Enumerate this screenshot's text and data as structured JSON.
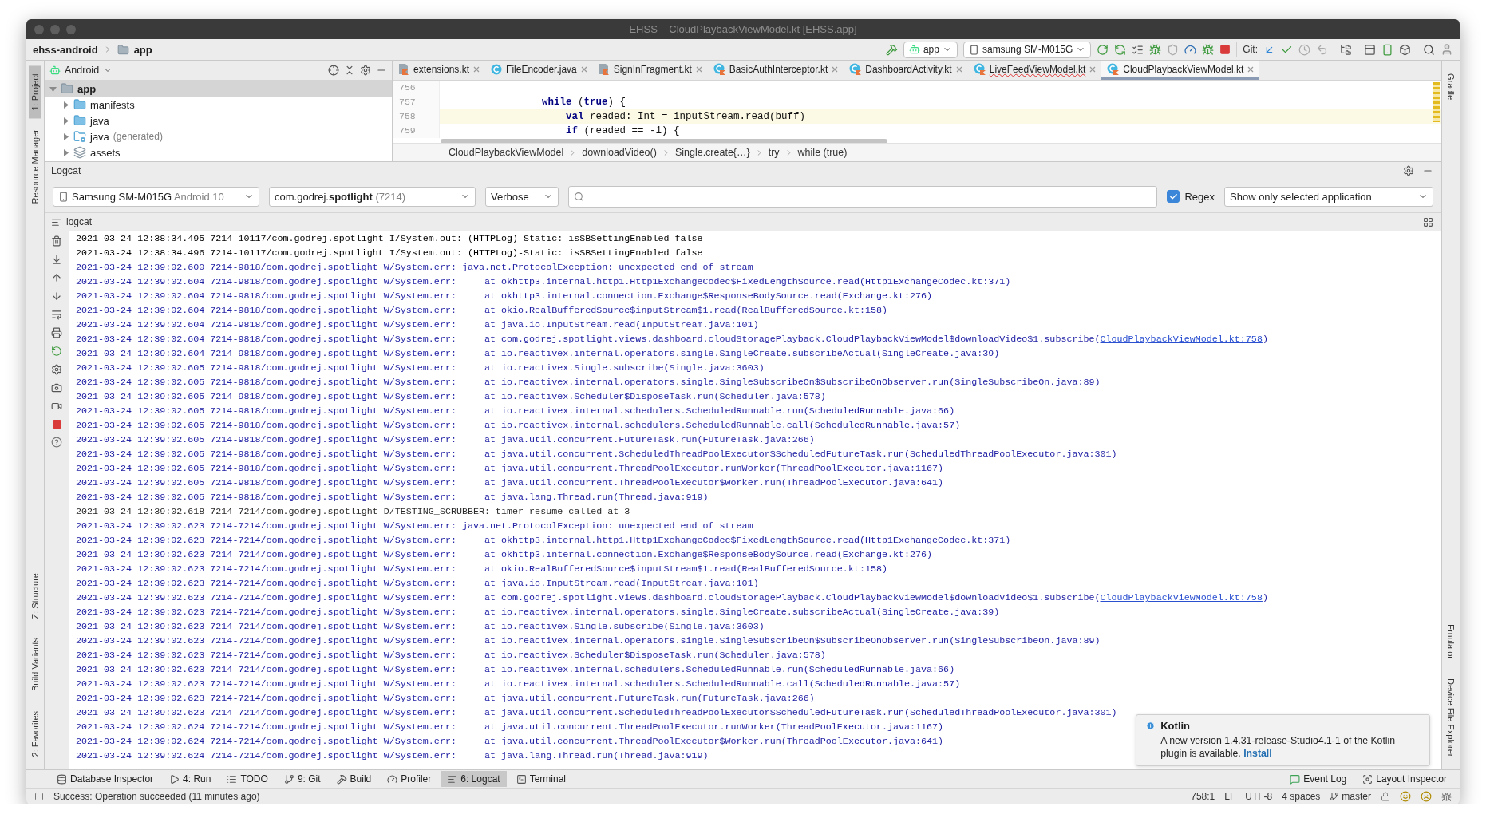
{
  "window": {
    "title": "EHSS – CloudPlaybackViewModel.kt [EHSS.app]"
  },
  "nav": {
    "crumbs": [
      {
        "label": "ehss-android",
        "kind": "project"
      },
      {
        "label": "app",
        "kind": "module"
      }
    ]
  },
  "toolbar": {
    "config": "app",
    "device": "samsung SM-M015G",
    "git_label": "Git:"
  },
  "left_stripe": {
    "top": [
      {
        "label": "1: Project",
        "selected": true
      },
      {
        "label": "Resource Manager",
        "selected": false
      }
    ],
    "bottom": [
      {
        "label": "Z: Structure",
        "selected": false
      },
      {
        "label": "Build Variants",
        "selected": false
      },
      {
        "label": "2: Favorites",
        "selected": false
      }
    ]
  },
  "right_stripe": {
    "top": [
      {
        "label": "Gradle",
        "selected": false
      }
    ],
    "bottom": [
      {
        "label": "Emulator",
        "selected": false
      },
      {
        "label": "Device File Explorer",
        "selected": false
      }
    ]
  },
  "project": {
    "view": "Android",
    "tree": [
      {
        "label": "app",
        "kind": "module",
        "selected": true,
        "expanded": true,
        "children": [
          {
            "label": "manifests",
            "kind": "folder",
            "selected": false,
            "expanded": false
          },
          {
            "label": "java",
            "kind": "folder",
            "selected": false,
            "expanded": false
          },
          {
            "label": "java",
            "note": "(generated)",
            "kind": "generated",
            "selected": false,
            "expanded": false
          },
          {
            "label": "assets",
            "kind": "assets",
            "selected": false,
            "expanded": false
          }
        ]
      }
    ]
  },
  "editor": {
    "tabs": [
      {
        "label": "extensions.kt",
        "kind": "kt-file",
        "selected": false,
        "error": false
      },
      {
        "label": "FileEncoder.java",
        "kind": "java-class",
        "selected": false,
        "error": false
      },
      {
        "label": "SignInFragment.kt",
        "kind": "kt-file",
        "selected": false,
        "error": false
      },
      {
        "label": "BasicAuthInterceptor.kt",
        "kind": "kt-class",
        "selected": false,
        "error": false
      },
      {
        "label": "DashboardActivity.kt",
        "kind": "kt-class",
        "selected": false,
        "error": false
      },
      {
        "label": "LiveFeedViewModel.kt",
        "kind": "kt-class",
        "selected": false,
        "error": true
      },
      {
        "label": "CloudPlaybackViewModel.kt",
        "kind": "kt-class",
        "selected": true,
        "error": false
      }
    ],
    "lines": [
      {
        "number": "756",
        "current": false
      },
      {
        "number": "757",
        "code": "                **while** (**true**) {",
        "current": false
      },
      {
        "number": "758",
        "code": "                    **val** readed: Int = inputStream.read(buff)",
        "current": true
      },
      {
        "number": "759",
        "code": "                    **if** (readed == -1) {",
        "current": false
      }
    ],
    "breadcrumbs": [
      "CloudPlaybackViewModel",
      "downloadVideo()",
      "Single.create{…}",
      "try",
      "while (true)"
    ]
  },
  "logcat": {
    "title": "Logcat",
    "device": "Samsung SM-M015G",
    "device_note": "Android 10",
    "process": "com.godrej.**spotlight**",
    "process_note": "(7214)",
    "level": "Verbose",
    "regex": {
      "label": "Regex",
      "checked": true
    },
    "filter": "Show only selected application",
    "subtitle": "logcat",
    "lines": [
      {
        "kind": "I",
        "text": "2021-03-24 12:38:34.495 7214-10117/com.godrej.spotlight I/System.out: (HTTPLog)-Static: isSBSettingEnabled false"
      },
      {
        "kind": "I",
        "text": "2021-03-24 12:38:34.496 7214-10117/com.godrej.spotlight I/System.out: (HTTPLog)-Static: isSBSettingEnabled false"
      },
      {
        "kind": "W",
        "text": "2021-03-24 12:39:02.600 7214-9818/com.godrej.spotlight W/System.err: java.net.ProtocolException: unexpected end of stream"
      },
      {
        "kind": "W",
        "text": "2021-03-24 12:39:02.604 7214-9818/com.godrej.spotlight W/System.err:     at okhttp3.internal.http1.Http1ExchangeCodec$FixedLengthSource.read(Http1ExchangeCodec.kt:371)"
      },
      {
        "kind": "W",
        "text": "2021-03-24 12:39:02.604 7214-9818/com.godrej.spotlight W/System.err:     at okhttp3.internal.connection.Exchange$ResponseBodySource.read(Exchange.kt:276)"
      },
      {
        "kind": "W",
        "text": "2021-03-24 12:39:02.604 7214-9818/com.godrej.spotlight W/System.err:     at okio.RealBufferedSource$inputStream$1.read(RealBufferedSource.kt:158)"
      },
      {
        "kind": "W",
        "text": "2021-03-24 12:39:02.604 7214-9818/com.godrej.spotlight W/System.err:     at java.io.InputStream.read(InputStream.java:101)"
      },
      {
        "kind": "W",
        "text": "2021-03-24 12:39:02.604 7214-9818/com.godrej.spotlight W/System.err:     at com.godrej.spotlight.views.dashboard.cloudStoragePlayback.CloudPlaybackViewModel$downloadVideo$1.subscribe(",
        "link": "CloudPlaybackViewModel.kt:758",
        "after": ")"
      },
      {
        "kind": "W",
        "text": "2021-03-24 12:39:02.604 7214-9818/com.godrej.spotlight W/System.err:     at io.reactivex.internal.operators.single.SingleCreate.subscribeActual(SingleCreate.java:39)"
      },
      {
        "kind": "W",
        "text": "2021-03-24 12:39:02.605 7214-9818/com.godrej.spotlight W/System.err:     at io.reactivex.Single.subscribe(Single.java:3603)"
      },
      {
        "kind": "W",
        "text": "2021-03-24 12:39:02.605 7214-9818/com.godrej.spotlight W/System.err:     at io.reactivex.internal.operators.single.SingleSubscribeOn$SubscribeOnObserver.run(SingleSubscribeOn.java:89)"
      },
      {
        "kind": "W",
        "text": "2021-03-24 12:39:02.605 7214-9818/com.godrej.spotlight W/System.err:     at io.reactivex.Scheduler$DisposeTask.run(Scheduler.java:578)"
      },
      {
        "kind": "W",
        "text": "2021-03-24 12:39:02.605 7214-9818/com.godrej.spotlight W/System.err:     at io.reactivex.internal.schedulers.ScheduledRunnable.run(ScheduledRunnable.java:66)"
      },
      {
        "kind": "W",
        "text": "2021-03-24 12:39:02.605 7214-9818/com.godrej.spotlight W/System.err:     at io.reactivex.internal.schedulers.ScheduledRunnable.call(ScheduledRunnable.java:57)"
      },
      {
        "kind": "W",
        "text": "2021-03-24 12:39:02.605 7214-9818/com.godrej.spotlight W/System.err:     at java.util.concurrent.FutureTask.run(FutureTask.java:266)"
      },
      {
        "kind": "W",
        "text": "2021-03-24 12:39:02.605 7214-9818/com.godrej.spotlight W/System.err:     at java.util.concurrent.ScheduledThreadPoolExecutor$ScheduledFutureTask.run(ScheduledThreadPoolExecutor.java:301)"
      },
      {
        "kind": "W",
        "text": "2021-03-24 12:39:02.605 7214-9818/com.godrej.spotlight W/System.err:     at java.util.concurrent.ThreadPoolExecutor.runWorker(ThreadPoolExecutor.java:1167)"
      },
      {
        "kind": "W",
        "text": "2021-03-24 12:39:02.605 7214-9818/com.godrej.spotlight W/System.err:     at java.util.concurrent.ThreadPoolExecutor$Worker.run(ThreadPoolExecutor.java:641)"
      },
      {
        "kind": "W",
        "text": "2021-03-24 12:39:02.605 7214-9818/com.godrej.spotlight W/System.err:     at java.lang.Thread.run(Thread.java:919)"
      },
      {
        "kind": "D",
        "text": "2021-03-24 12:39:02.618 7214-7214/com.godrej.spotlight D/TESTING_SCRUBBER: timer resume called at 3"
      },
      {
        "kind": "W",
        "text": "2021-03-24 12:39:02.623 7214-7214/com.godrej.spotlight W/System.err: java.net.ProtocolException: unexpected end of stream"
      },
      {
        "kind": "W",
        "text": "2021-03-24 12:39:02.623 7214-7214/com.godrej.spotlight W/System.err:     at okhttp3.internal.http1.Http1ExchangeCodec$FixedLengthSource.read(Http1ExchangeCodec.kt:371)"
      },
      {
        "kind": "W",
        "text": "2021-03-24 12:39:02.623 7214-7214/com.godrej.spotlight W/System.err:     at okhttp3.internal.connection.Exchange$ResponseBodySource.read(Exchange.kt:276)"
      },
      {
        "kind": "W",
        "text": "2021-03-24 12:39:02.623 7214-7214/com.godrej.spotlight W/System.err:     at okio.RealBufferedSource$inputStream$1.read(RealBufferedSource.kt:158)"
      },
      {
        "kind": "W",
        "text": "2021-03-24 12:39:02.623 7214-7214/com.godrej.spotlight W/System.err:     at java.io.InputStream.read(InputStream.java:101)"
      },
      {
        "kind": "W",
        "text": "2021-03-24 12:39:02.623 7214-7214/com.godrej.spotlight W/System.err:     at com.godrej.spotlight.views.dashboard.cloudStoragePlayback.CloudPlaybackViewModel$downloadVideo$1.subscribe(",
        "link": "CloudPlaybackViewModel.kt:758",
        "after": ")"
      },
      {
        "kind": "W",
        "text": "2021-03-24 12:39:02.623 7214-7214/com.godrej.spotlight W/System.err:     at io.reactivex.internal.operators.single.SingleCreate.subscribeActual(SingleCreate.java:39)"
      },
      {
        "kind": "W",
        "text": "2021-03-24 12:39:02.623 7214-7214/com.godrej.spotlight W/System.err:     at io.reactivex.Single.subscribe(Single.java:3603)"
      },
      {
        "kind": "W",
        "text": "2021-03-24 12:39:02.623 7214-7214/com.godrej.spotlight W/System.err:     at io.reactivex.internal.operators.single.SingleSubscribeOn$SubscribeOnObserver.run(SingleSubscribeOn.java:89)"
      },
      {
        "kind": "W",
        "text": "2021-03-24 12:39:02.623 7214-7214/com.godrej.spotlight W/System.err:     at io.reactivex.Scheduler$DisposeTask.run(Scheduler.java:578)"
      },
      {
        "kind": "W",
        "text": "2021-03-24 12:39:02.623 7214-7214/com.godrej.spotlight W/System.err:     at io.reactivex.internal.schedulers.ScheduledRunnable.run(ScheduledRunnable.java:66)"
      },
      {
        "kind": "W",
        "text": "2021-03-24 12:39:02.623 7214-7214/com.godrej.spotlight W/System.err:     at io.reactivex.internal.schedulers.ScheduledRunnable.call(ScheduledRunnable.java:57)"
      },
      {
        "kind": "W",
        "text": "2021-03-24 12:39:02.623 7214-7214/com.godrej.spotlight W/System.err:     at java.util.concurrent.FutureTask.run(FutureTask.java:266)"
      },
      {
        "kind": "W",
        "text": "2021-03-24 12:39:02.623 7214-7214/com.godrej.spotlight W/System.err:     at java.util.concurrent.ScheduledThreadPoolExecutor$ScheduledFutureTask.run(ScheduledThreadPoolExecutor.java:301)"
      },
      {
        "kind": "W",
        "text": "2021-03-24 12:39:02.624 7214-7214/com.godrej.spotlight W/System.err:     at java.util.concurrent.ThreadPoolExecutor.runWorker(ThreadPoolExecutor.java:1167)"
      },
      {
        "kind": "W",
        "text": "2021-03-24 12:39:02.624 7214-7214/com.godrej.spotlight W/System.err:     at java.util.concurrent.ThreadPoolExecutor$Worker.run(ThreadPoolExecutor.java:641)"
      },
      {
        "kind": "W",
        "text": "2021-03-24 12:39:02.624 7214-7214/com.godrej.spotlight W/System.err:     at java.lang.Thread.run(Thread.java:919)"
      }
    ]
  },
  "notification": {
    "title": "Kotlin",
    "message": "A new version 1.4.31-release-Studio4.1-1 of the Kotlin plugin is available.",
    "action": "Install"
  },
  "tool_windows": {
    "left": [
      {
        "label": "Database Inspector",
        "kind": "database",
        "selected": false
      },
      {
        "label": "4: Run",
        "kind": "run",
        "selected": false
      },
      {
        "label": "TODO",
        "kind": "todo",
        "selected": false
      },
      {
        "label": "9: Git",
        "kind": "git",
        "selected": false
      },
      {
        "label": "Build",
        "kind": "build",
        "selected": false
      },
      {
        "label": "Profiler",
        "kind": "profiler",
        "selected": false
      },
      {
        "label": "6: Logcat",
        "kind": "logcat",
        "selected": true
      },
      {
        "label": "Terminal",
        "kind": "terminal",
        "selected": false
      }
    ],
    "right": [
      {
        "label": "Event Log",
        "kind": "event",
        "selected": false
      },
      {
        "label": "Layout Inspector",
        "kind": "layout",
        "selected": false
      }
    ]
  },
  "status": {
    "message": "Success: Operation succeeded (11 minutes ago)",
    "position": "758:1",
    "line_sep": "LF",
    "encoding": "UTF-8",
    "indent": "4 spaces",
    "branch": "master"
  }
}
